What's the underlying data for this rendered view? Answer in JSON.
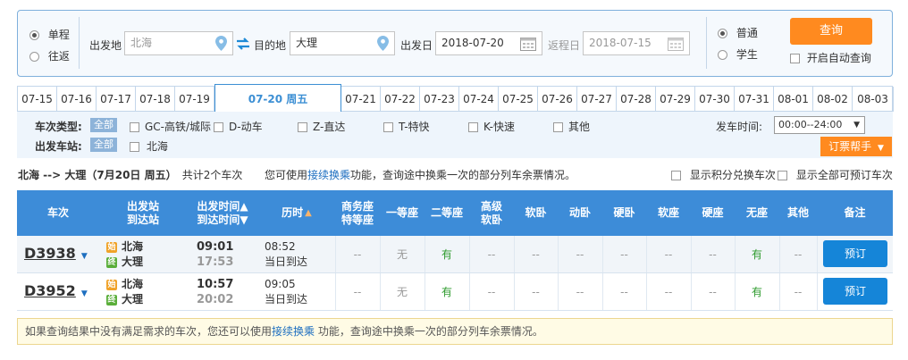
{
  "search": {
    "trip_single": "单程",
    "trip_round": "往返",
    "from_label": "出发地",
    "from_value": "北海",
    "to_label": "目的地",
    "to_value": "大理",
    "depart_label": "出发日",
    "depart_value": "2018-07-20",
    "return_label": "返程日",
    "return_value": "2018-07-15",
    "type_normal": "普通",
    "type_student": "学生",
    "query_button": "查询",
    "auto_query": "开启自动查询"
  },
  "date_tabs": [
    "07-15",
    "07-16",
    "07-17",
    "07-18",
    "07-19",
    "07-20 周五",
    "07-21",
    "07-22",
    "07-23",
    "07-24",
    "07-25",
    "07-26",
    "07-27",
    "07-28",
    "07-29",
    "07-30",
    "07-31",
    "08-01",
    "08-02",
    "08-03"
  ],
  "active_date": "07-20 周五",
  "filters": {
    "train_type_label": "车次类型:",
    "all": "全部",
    "types": [
      "GC-高铁/城际",
      "D-动车",
      "Z-直达",
      "T-特快",
      "K-快速",
      "其他"
    ],
    "station_label": "出发车站:",
    "stations": [
      "北海"
    ],
    "depart_time_label": "发车时间:",
    "depart_time_value": "00:00--24:00",
    "helper_button": "订票帮手"
  },
  "summary": {
    "route": "北海 --> 大理（7月20日 周五）",
    "count": "共计2个车次",
    "hint_pre": "您可使用",
    "hint_link": "接续换乘",
    "hint_post": "功能，查询途中换乘一次的部分列车余票情况。",
    "opt_points": "显示积分兑换车次",
    "opt_bookable": "显示全部可预订车次"
  },
  "table": {
    "headers": {
      "train": "车次",
      "station_1": "出发站",
      "station_2": "到达站",
      "time_1": "出发时间▲",
      "time_2": "到达时间▼",
      "duration": "历时",
      "business_1": "商务座",
      "business_2": "特等座",
      "first": "一等座",
      "second": "二等座",
      "soft_sleeper_1": "高级",
      "soft_sleeper_2": "软卧",
      "soft_sleeper": "软卧",
      "motion_sleeper": "动卧",
      "hard_sleeper": "硬卧",
      "soft_seat": "软座",
      "hard_seat": "硬座",
      "no_seat": "无座",
      "other": "其他",
      "remark": "备注"
    },
    "rows": [
      {
        "train": "D3938",
        "start_icon": "始",
        "end_icon": "终",
        "from": "北海",
        "to": "大理",
        "depart": "09:01",
        "arrive": "17:53",
        "duration": "08:52",
        "arrival_day": "当日到达",
        "seats": [
          "--",
          "无",
          "有",
          "--",
          "--",
          "--",
          "--",
          "--",
          "--",
          "有",
          "--"
        ],
        "book": "预订"
      },
      {
        "train": "D3952",
        "start_icon": "始",
        "end_icon": "终",
        "from": "北海",
        "to": "大理",
        "depart": "10:57",
        "arrive": "20:02",
        "duration": "09:05",
        "arrival_day": "当日到达",
        "seats": [
          "--",
          "无",
          "有",
          "--",
          "--",
          "--",
          "--",
          "--",
          "--",
          "有",
          "--"
        ],
        "book": "预订"
      }
    ]
  },
  "note": {
    "pre": "如果查询结果中没有满足需求的车次，您还可以使用",
    "link": "接续换乘",
    "post": " 功能，查询途中换乘一次的部分列车余票情况。"
  }
}
